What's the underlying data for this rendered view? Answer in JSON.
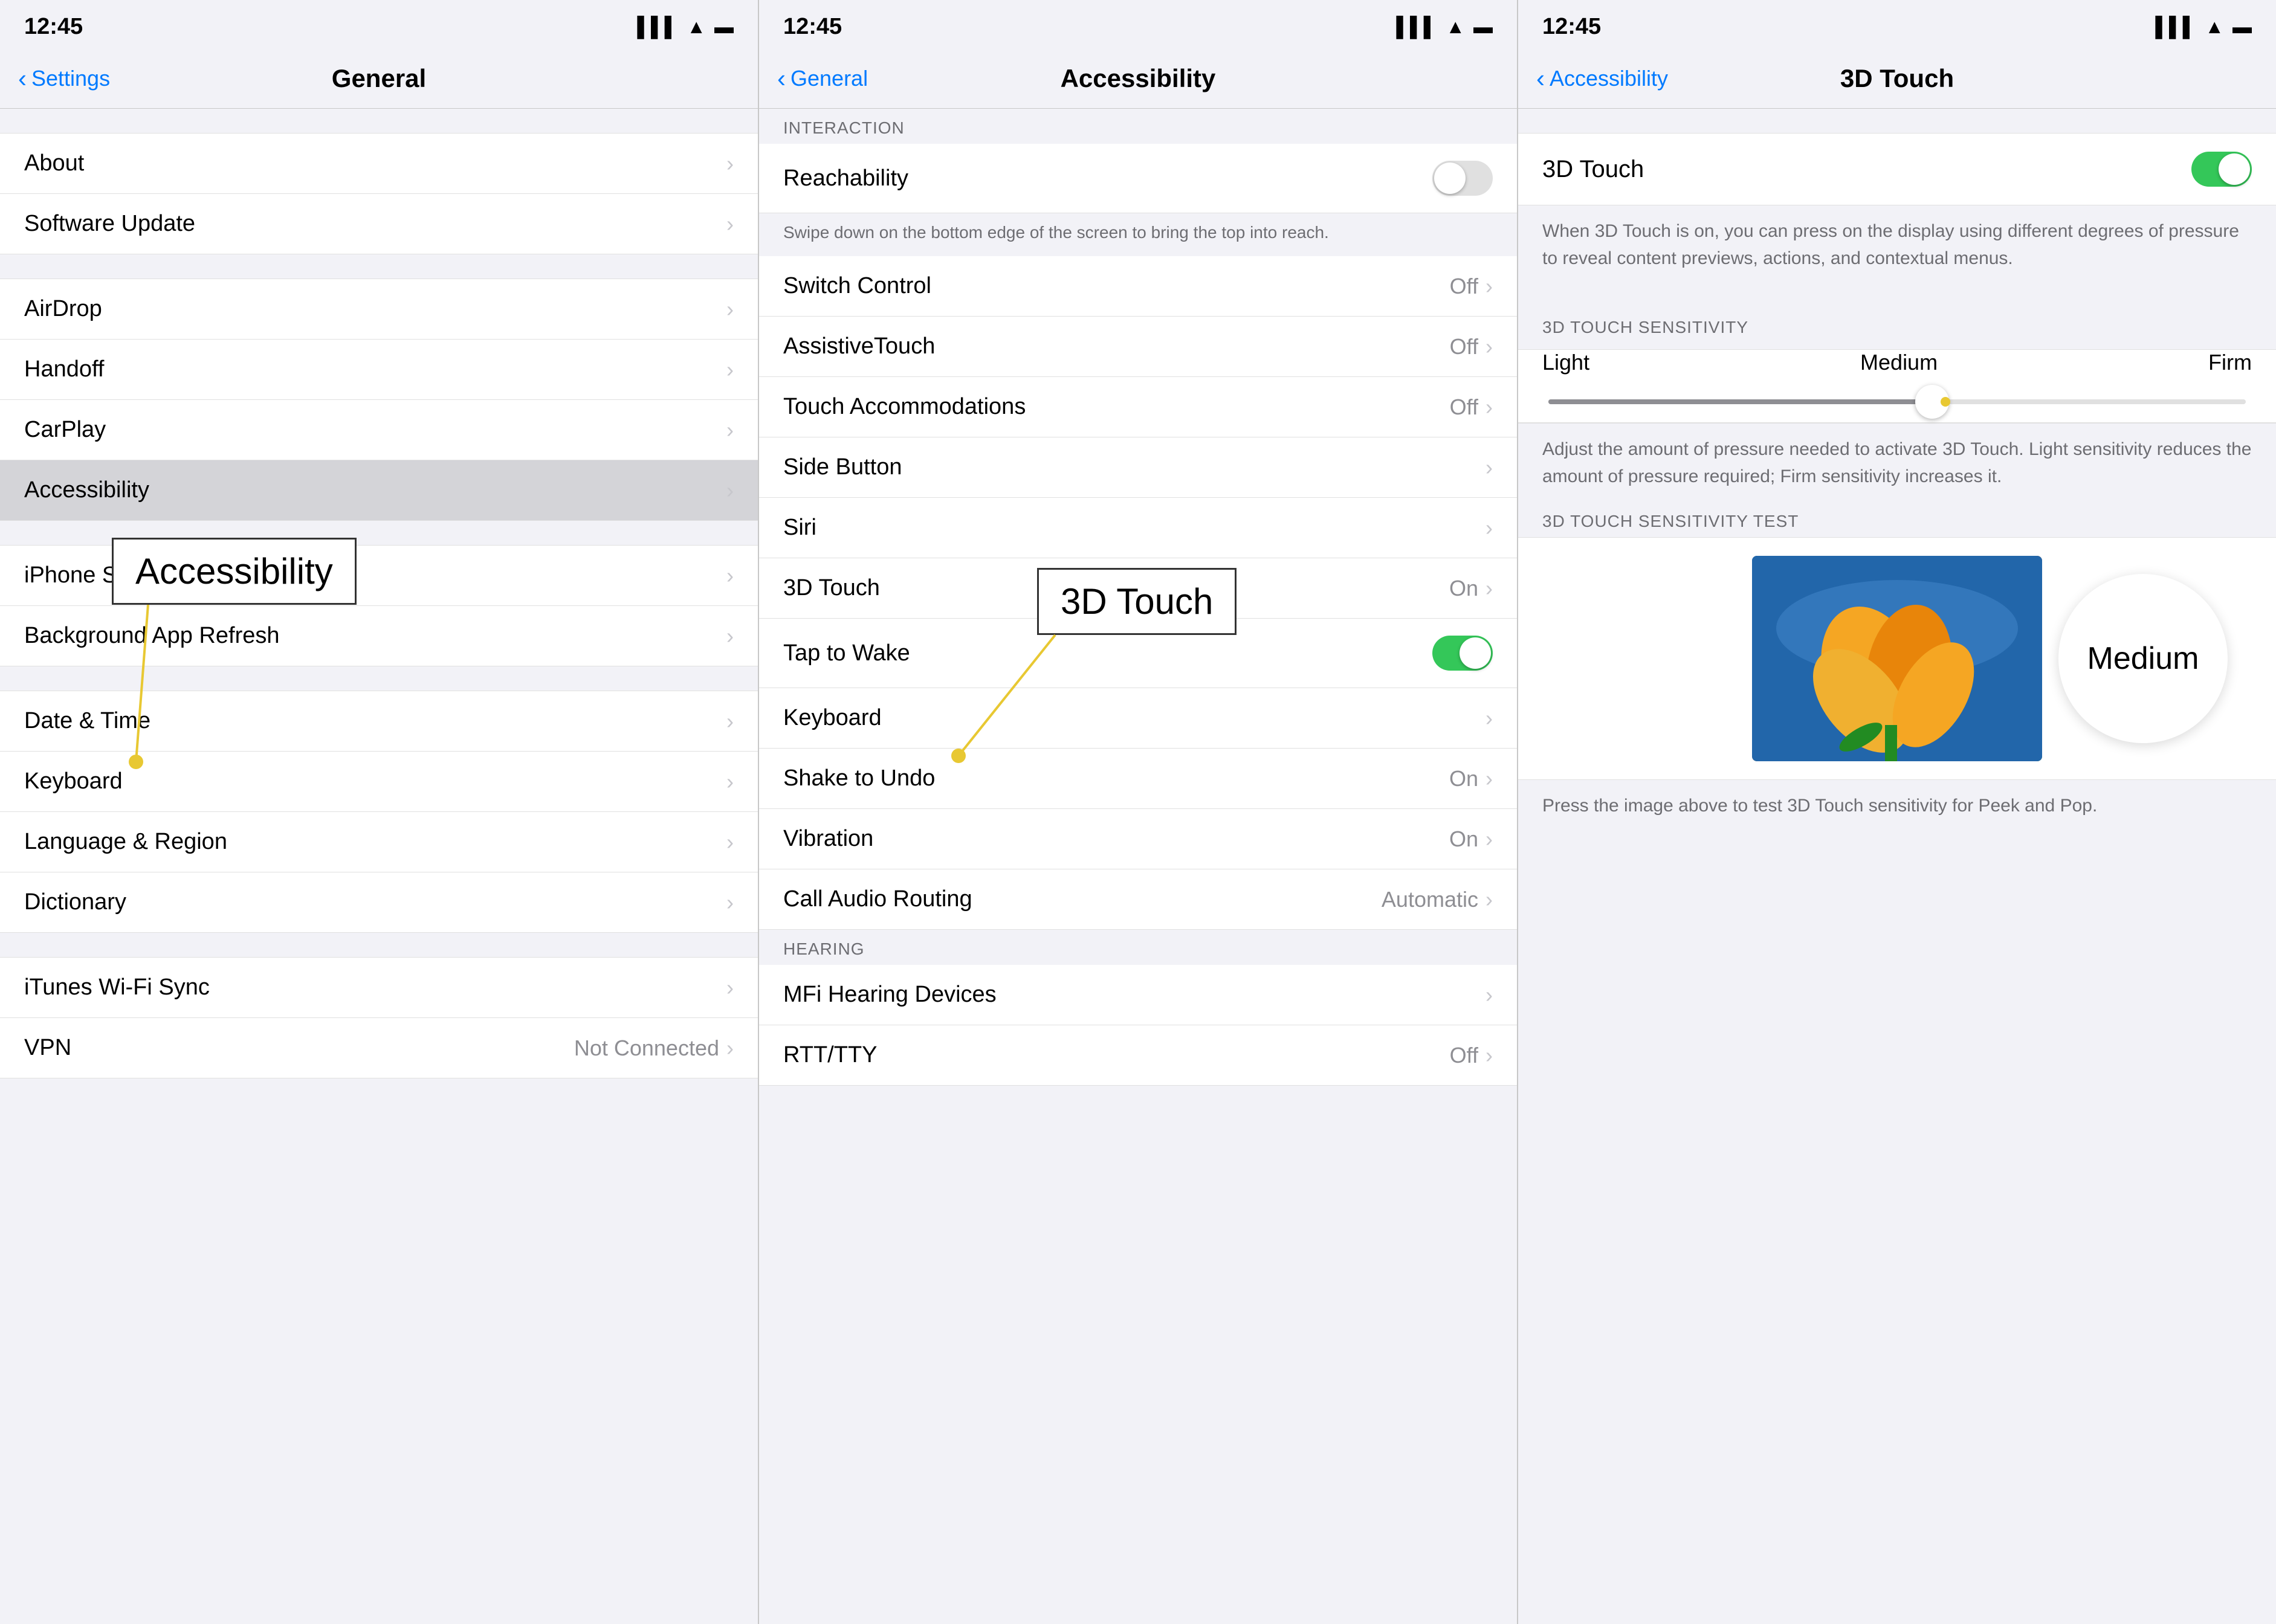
{
  "panel1": {
    "statusBar": {
      "time": "12:45",
      "timeArrow": "◀",
      "signal": "▌▌▌",
      "wifi": "WiFi",
      "battery": "🔋"
    },
    "navBack": "Settings",
    "navTitle": "General",
    "items": [
      {
        "label": "About",
        "value": "",
        "chevron": true
      },
      {
        "label": "Software Update",
        "value": "",
        "chevron": true
      },
      {
        "label": "AirDrop",
        "value": "",
        "chevron": true
      },
      {
        "label": "Handoff",
        "value": "",
        "chevron": true
      },
      {
        "label": "CarPlay",
        "value": "",
        "chevron": true
      },
      {
        "label": "Accessibility",
        "value": "",
        "chevron": true,
        "highlighted": true
      },
      {
        "label": "iPhone Storage",
        "value": "",
        "chevron": true
      },
      {
        "label": "Background App Refresh",
        "value": "",
        "chevron": true
      },
      {
        "label": "Date & Time",
        "value": "",
        "chevron": true
      },
      {
        "label": "Keyboard",
        "value": "",
        "chevron": true
      },
      {
        "label": "Language & Region",
        "value": "",
        "chevron": true
      },
      {
        "label": "Dictionary",
        "value": "",
        "chevron": true
      },
      {
        "label": "iTunes Wi-Fi Sync",
        "value": "",
        "chevron": true
      },
      {
        "label": "VPN",
        "value": "Not Connected",
        "chevron": true
      }
    ],
    "callout": {
      "text": "Accessibility"
    }
  },
  "panel2": {
    "statusBar": {
      "time": "12:45"
    },
    "navBack": "General",
    "navTitle": "Accessibility",
    "sections": [
      {
        "header": "INTERACTION",
        "items": [
          {
            "label": "Reachability",
            "value": "",
            "toggle": true,
            "toggleOn": false,
            "footer": "Swipe down on the bottom edge of the screen to bring the top into reach."
          },
          {
            "label": "Switch Control",
            "value": "Off",
            "chevron": true
          },
          {
            "label": "AssistiveTouch",
            "value": "Off",
            "chevron": true
          },
          {
            "label": "Touch Accommodations",
            "value": "Off",
            "chevron": true
          },
          {
            "label": "Side Button",
            "value": "",
            "chevron": true
          },
          {
            "label": "Siri",
            "value": "",
            "chevron": true
          },
          {
            "label": "3D Touch",
            "value": "On",
            "chevron": true
          },
          {
            "label": "Tap to Wake",
            "value": "",
            "toggle": true,
            "toggleOn": true
          },
          {
            "label": "Keyboard",
            "value": "",
            "chevron": true
          },
          {
            "label": "Shake to Undo",
            "value": "On",
            "chevron": true
          },
          {
            "label": "Vibration",
            "value": "On",
            "chevron": true
          },
          {
            "label": "Call Audio Routing",
            "value": "Automatic",
            "chevron": true
          }
        ]
      },
      {
        "header": "HEARING",
        "items": [
          {
            "label": "MFi Hearing Devices",
            "value": "",
            "chevron": true
          },
          {
            "label": "RTT/TTY",
            "value": "Off",
            "chevron": true
          }
        ]
      }
    ],
    "callout": {
      "text": "3D Touch"
    }
  },
  "panel3": {
    "statusBar": {
      "time": "12:45"
    },
    "navBack": "Accessibility",
    "navTitle": "3D Touch",
    "toggle3DTouch": true,
    "toggleDesc": "When 3D Touch is on, you can press on the display using different degrees of pressure to reveal content previews, actions, and contextual menus.",
    "sensitivityHeader": "3D TOUCH SENSITIVITY",
    "sensitivityLabels": [
      "Light",
      "Medium",
      "Firm"
    ],
    "sensitivityDesc": "Adjust the amount of pressure needed to activate 3D Touch. Light sensitivity reduces the amount of pressure required; Firm sensitivity increases it.",
    "testHeader": "3D TOUCH SENSITIVITY TEST",
    "testDesc": "Press the image above to test 3D Touch sensitivity for Peek and Pop.",
    "mediumCallout": "Medium",
    "sensitivityLightLabel": "Light",
    "sensitivityMediumLabel": "Medium",
    "sensitivityFirmLabel": "Firm"
  },
  "annotation1": {
    "label": "Accessibility"
  },
  "annotation2": {
    "label": "3D Touch"
  },
  "annotation3": {
    "label": "Medium"
  }
}
